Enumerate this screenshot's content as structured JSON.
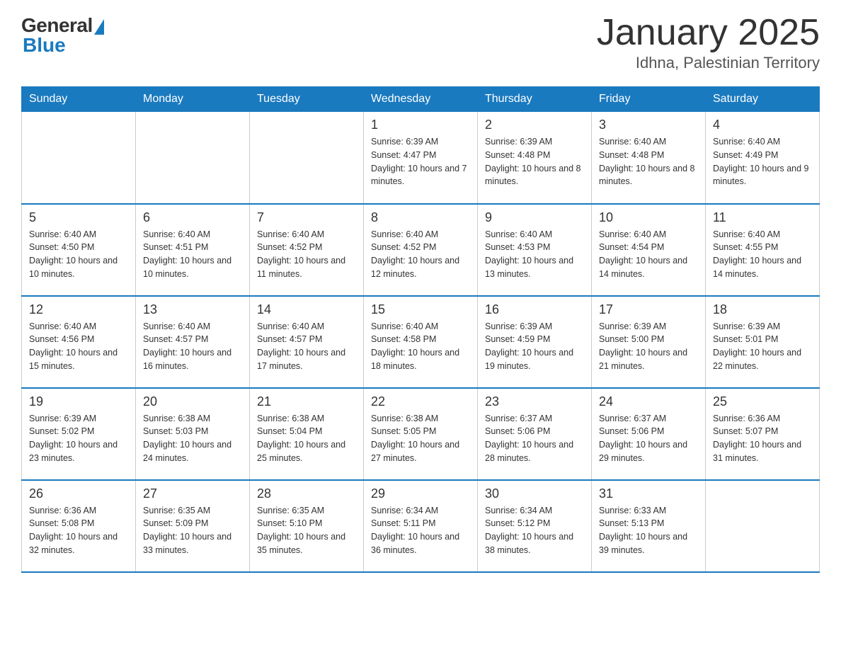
{
  "logo": {
    "general": "General",
    "blue": "Blue",
    "subtitle": "Blue"
  },
  "title": "January 2025",
  "location": "Idhna, Palestinian Territory",
  "days_of_week": [
    "Sunday",
    "Monday",
    "Tuesday",
    "Wednesday",
    "Thursday",
    "Friday",
    "Saturday"
  ],
  "weeks": [
    [
      {
        "day": "",
        "info": ""
      },
      {
        "day": "",
        "info": ""
      },
      {
        "day": "",
        "info": ""
      },
      {
        "day": "1",
        "info": "Sunrise: 6:39 AM\nSunset: 4:47 PM\nDaylight: 10 hours and 7 minutes."
      },
      {
        "day": "2",
        "info": "Sunrise: 6:39 AM\nSunset: 4:48 PM\nDaylight: 10 hours and 8 minutes."
      },
      {
        "day": "3",
        "info": "Sunrise: 6:40 AM\nSunset: 4:48 PM\nDaylight: 10 hours and 8 minutes."
      },
      {
        "day": "4",
        "info": "Sunrise: 6:40 AM\nSunset: 4:49 PM\nDaylight: 10 hours and 9 minutes."
      }
    ],
    [
      {
        "day": "5",
        "info": "Sunrise: 6:40 AM\nSunset: 4:50 PM\nDaylight: 10 hours and 10 minutes."
      },
      {
        "day": "6",
        "info": "Sunrise: 6:40 AM\nSunset: 4:51 PM\nDaylight: 10 hours and 10 minutes."
      },
      {
        "day": "7",
        "info": "Sunrise: 6:40 AM\nSunset: 4:52 PM\nDaylight: 10 hours and 11 minutes."
      },
      {
        "day": "8",
        "info": "Sunrise: 6:40 AM\nSunset: 4:52 PM\nDaylight: 10 hours and 12 minutes."
      },
      {
        "day": "9",
        "info": "Sunrise: 6:40 AM\nSunset: 4:53 PM\nDaylight: 10 hours and 13 minutes."
      },
      {
        "day": "10",
        "info": "Sunrise: 6:40 AM\nSunset: 4:54 PM\nDaylight: 10 hours and 14 minutes."
      },
      {
        "day": "11",
        "info": "Sunrise: 6:40 AM\nSunset: 4:55 PM\nDaylight: 10 hours and 14 minutes."
      }
    ],
    [
      {
        "day": "12",
        "info": "Sunrise: 6:40 AM\nSunset: 4:56 PM\nDaylight: 10 hours and 15 minutes."
      },
      {
        "day": "13",
        "info": "Sunrise: 6:40 AM\nSunset: 4:57 PM\nDaylight: 10 hours and 16 minutes."
      },
      {
        "day": "14",
        "info": "Sunrise: 6:40 AM\nSunset: 4:57 PM\nDaylight: 10 hours and 17 minutes."
      },
      {
        "day": "15",
        "info": "Sunrise: 6:40 AM\nSunset: 4:58 PM\nDaylight: 10 hours and 18 minutes."
      },
      {
        "day": "16",
        "info": "Sunrise: 6:39 AM\nSunset: 4:59 PM\nDaylight: 10 hours and 19 minutes."
      },
      {
        "day": "17",
        "info": "Sunrise: 6:39 AM\nSunset: 5:00 PM\nDaylight: 10 hours and 21 minutes."
      },
      {
        "day": "18",
        "info": "Sunrise: 6:39 AM\nSunset: 5:01 PM\nDaylight: 10 hours and 22 minutes."
      }
    ],
    [
      {
        "day": "19",
        "info": "Sunrise: 6:39 AM\nSunset: 5:02 PM\nDaylight: 10 hours and 23 minutes."
      },
      {
        "day": "20",
        "info": "Sunrise: 6:38 AM\nSunset: 5:03 PM\nDaylight: 10 hours and 24 minutes."
      },
      {
        "day": "21",
        "info": "Sunrise: 6:38 AM\nSunset: 5:04 PM\nDaylight: 10 hours and 25 minutes."
      },
      {
        "day": "22",
        "info": "Sunrise: 6:38 AM\nSunset: 5:05 PM\nDaylight: 10 hours and 27 minutes."
      },
      {
        "day": "23",
        "info": "Sunrise: 6:37 AM\nSunset: 5:06 PM\nDaylight: 10 hours and 28 minutes."
      },
      {
        "day": "24",
        "info": "Sunrise: 6:37 AM\nSunset: 5:06 PM\nDaylight: 10 hours and 29 minutes."
      },
      {
        "day": "25",
        "info": "Sunrise: 6:36 AM\nSunset: 5:07 PM\nDaylight: 10 hours and 31 minutes."
      }
    ],
    [
      {
        "day": "26",
        "info": "Sunrise: 6:36 AM\nSunset: 5:08 PM\nDaylight: 10 hours and 32 minutes."
      },
      {
        "day": "27",
        "info": "Sunrise: 6:35 AM\nSunset: 5:09 PM\nDaylight: 10 hours and 33 minutes."
      },
      {
        "day": "28",
        "info": "Sunrise: 6:35 AM\nSunset: 5:10 PM\nDaylight: 10 hours and 35 minutes."
      },
      {
        "day": "29",
        "info": "Sunrise: 6:34 AM\nSunset: 5:11 PM\nDaylight: 10 hours and 36 minutes."
      },
      {
        "day": "30",
        "info": "Sunrise: 6:34 AM\nSunset: 5:12 PM\nDaylight: 10 hours and 38 minutes."
      },
      {
        "day": "31",
        "info": "Sunrise: 6:33 AM\nSunset: 5:13 PM\nDaylight: 10 hours and 39 minutes."
      },
      {
        "day": "",
        "info": ""
      }
    ]
  ]
}
